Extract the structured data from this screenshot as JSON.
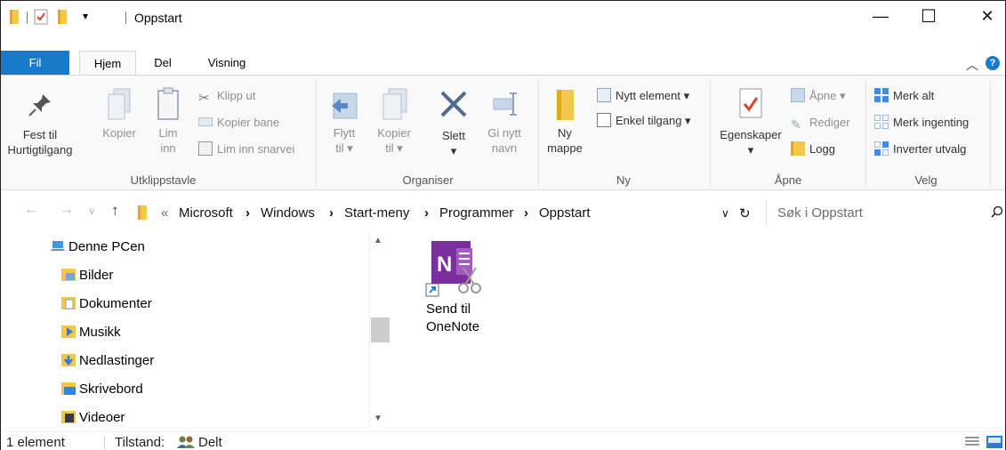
{
  "title_bar": {
    "title": "Oppstart",
    "quick_access_dropdown": "▾",
    "minimize": "—",
    "maximize": "☐",
    "close": "✕"
  },
  "tabs": [
    {
      "label": "Fil"
    },
    {
      "label": "Hjem"
    },
    {
      "label": "Del"
    },
    {
      "label": "Visning"
    }
  ],
  "ribbon": {
    "utklippstavle": {
      "label": "Utklippstavle",
      "fest_til_1": "Fest til",
      "fest_til_2": "Hurtigtilgang",
      "kopier": "Kopier",
      "lim_1": "Lim",
      "lim_2": "inn",
      "klipp_ut": "Klipp ut",
      "kopier_bane": "Kopier bane",
      "lim_inn_snarvei": "Lim inn snarvei"
    },
    "organiser": {
      "label": "Organiser",
      "flytt_1": "Flytt",
      "flytt_2": "til ▾",
      "kopier_1": "Kopier",
      "kopier_2": "til ▾",
      "slett_1": "Slett",
      "slett_2": "▾",
      "gi_nytt_1": "Gi nytt",
      "gi_nytt_2": "navn"
    },
    "ny": {
      "label": "Ny",
      "ny_mappe_1": "Ny",
      "ny_mappe_2": "mappe",
      "nytt_element": "Nytt element ▾",
      "enkel_tilgang": "Enkel tilgang ▾"
    },
    "apne": {
      "label": "Åpne",
      "egenskaper_1": "Egenskaper",
      "egenskaper_2": "▾",
      "apne": "Åpne ▾",
      "rediger": "Rediger",
      "logg": "Logg"
    },
    "velg": {
      "label": "Velg",
      "merk_alt": "Merk alt",
      "merk_ingenting": "Merk ingenting",
      "inverter_utvalg": "Inverter utvalg"
    }
  },
  "address": {
    "overflow": "«",
    "crumbs": [
      "Microsoft",
      "Windows",
      "Start-meny",
      "Programmer",
      "Oppstart"
    ],
    "separator": "›",
    "search_placeholder": "Søk i Oppstart"
  },
  "nav_pane": {
    "items": [
      {
        "label": "Denne PCen"
      },
      {
        "label": "Bilder"
      },
      {
        "label": "Dokumenter"
      },
      {
        "label": "Musikk"
      },
      {
        "label": "Nedlastinger"
      },
      {
        "label": "Skrivebord"
      },
      {
        "label": "Videoer"
      }
    ]
  },
  "files": [
    {
      "label_line1": "Send til",
      "label_line2": "OneNote"
    }
  ],
  "status": {
    "count": "1 element",
    "state_label": "Tilstand:",
    "state_value": "Delt"
  },
  "colors": {
    "accent": "#1979ca",
    "onenote": "#7b2f9e",
    "folder": "#f3c64c"
  }
}
